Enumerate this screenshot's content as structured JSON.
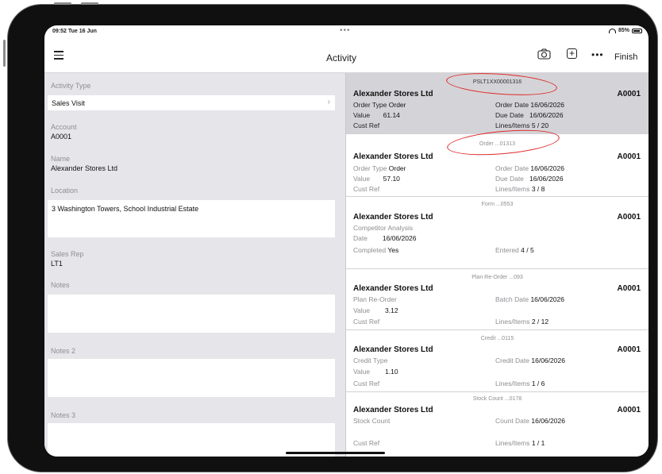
{
  "status": {
    "time": "09:52  Tue 16 Jun",
    "dots": "•••",
    "battery": "85%"
  },
  "nav": {
    "title": "Activity",
    "finish": "Finish"
  },
  "form": {
    "activity_type_label": "Activity Type",
    "activity_type_value": "Sales Visit",
    "account_label": "Account",
    "account_value": "A0001",
    "name_label": "Name",
    "name_value": "Alexander Stores Ltd",
    "location_label": "Location",
    "location_value": "3 Washington Towers, School Industrial Estate",
    "sales_rep_label": "Sales Rep",
    "sales_rep_value": "LT1",
    "notes_label": "Notes",
    "notes_value": "",
    "notes2_label": "Notes 2",
    "notes2_value": "",
    "notes3_label": "Notes 3",
    "notes3_value": ""
  },
  "items": [
    {
      "ref": "PSLT1XX00001316",
      "name": "Alexander Stores Ltd",
      "account": "A0001",
      "l1_label": "Order Type",
      "l1_value": "Order",
      "l2_label": "Value",
      "l2_value": "61.14",
      "l3_label": "Cust Ref",
      "r1_label": "Order Date",
      "r1_value": "16/06/2026",
      "r2_label": "Due Date",
      "r2_value": "16/06/2026",
      "r3_label": "Lines/Items",
      "r3_value": "5 / 20"
    },
    {
      "ref": "Order ...01313",
      "name": "Alexander Stores Ltd",
      "account": "A0001",
      "l1_label": "Order Type",
      "l1_value": "Order",
      "l2_label": "Value",
      "l2_value": "57.10",
      "l3_label": "Cust Ref",
      "r1_label": "Order Date",
      "r1_value": "16/06/2026",
      "r2_label": "Due Date",
      "r2_value": "16/06/2026",
      "r3_label": "Lines/Items",
      "r3_value": "3 / 8"
    },
    {
      "ref": "Form ...0553",
      "name": "Alexander Stores Ltd",
      "account": "A0001",
      "l1_label": "Competitor Analysis",
      "l2_label": "Date",
      "l2_value": "16/06/2026",
      "l3_label": "Completed",
      "l3_value": "Yes",
      "r3_label": "Entered",
      "r3_value": "4 / 5"
    },
    {
      "ref": "Plan Re-Order ...093",
      "name": "Alexander Stores Ltd",
      "account": "A0001",
      "l1_label": "Plan Re-Order",
      "l2_label": "Value",
      "l2_value": "3.12",
      "l3_label": "Cust Ref",
      "r1_label": "Batch Date",
      "r1_value": "16/06/2026",
      "r3_label": "Lines/Items",
      "r3_value": "2 / 12"
    },
    {
      "ref": "Credit ...0115",
      "name": "Alexander Stores Ltd",
      "account": "A0001",
      "l1_label": "Credit Type",
      "l2_label": "Value",
      "l2_value": "1.10",
      "l3_label": "Cust Ref",
      "r1_label": "Credit Date",
      "r1_value": "16/06/2026",
      "r3_label": "Lines/Items",
      "r3_value": "1 / 6"
    },
    {
      "ref": "Stock Count ...0178",
      "name": "Alexander Stores Ltd",
      "account": "A0001",
      "l1_label": "Stock Count",
      "l3_label": "Cust Ref",
      "r1_label": "Count Date",
      "r1_value": "16/06/2026",
      "r3_label": "Lines/Items",
      "r3_value": "1 / 1"
    }
  ],
  "annotation_color": "#e02828",
  "icons": {
    "menu": "hamburger-icon",
    "camera": "camera-icon",
    "add": "plus-square-icon",
    "more": "ellipsis-icon",
    "chevron": "chevron-right-icon"
  }
}
